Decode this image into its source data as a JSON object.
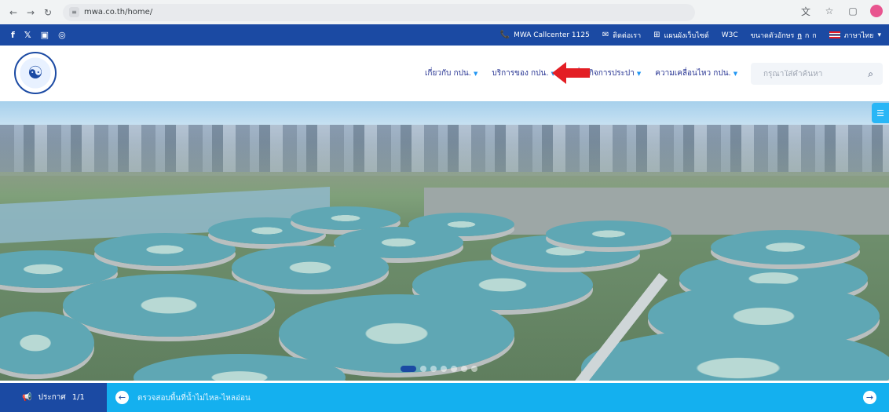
{
  "browser": {
    "url": "mwa.co.th/home/",
    "back_icon": "back-arrow",
    "forward_icon": "forward-arrow",
    "reload_icon": "reload",
    "site_icon": "site-settings"
  },
  "topbar": {
    "social": [
      "f",
      "𝕏",
      "▣",
      "◎"
    ],
    "callcenter": "MWA Callcenter 1125",
    "contact": "ติดต่อเรา",
    "sitemap": "แผนผังเว็บไซต์",
    "w3c": "W3C",
    "font_size_label": "ขนาดตัวอักษร",
    "font_sizes": [
      "ก",
      "ก",
      "ก"
    ],
    "language": "ภาษาไทย"
  },
  "header": {
    "menu": [
      {
        "label": "เกี่ยวกับ กปน."
      },
      {
        "label": "บริการของ กปน."
      },
      {
        "label": "รู้เรื่องกิจการประปา"
      },
      {
        "label": "ความเคลื่อนไหว กปน."
      }
    ],
    "search_placeholder": "กรุณาใส่คำค้นหา"
  },
  "announcement": {
    "label": "ประกาศ",
    "counter": "1/1",
    "text": "ตรวจสอบพื้นที่น้ำไม่ไหล-ไหลอ่อน"
  },
  "colors": {
    "topbar": "#1b4aa3",
    "announce_bar": "#14b0ef",
    "arrow": "#e31e24"
  }
}
